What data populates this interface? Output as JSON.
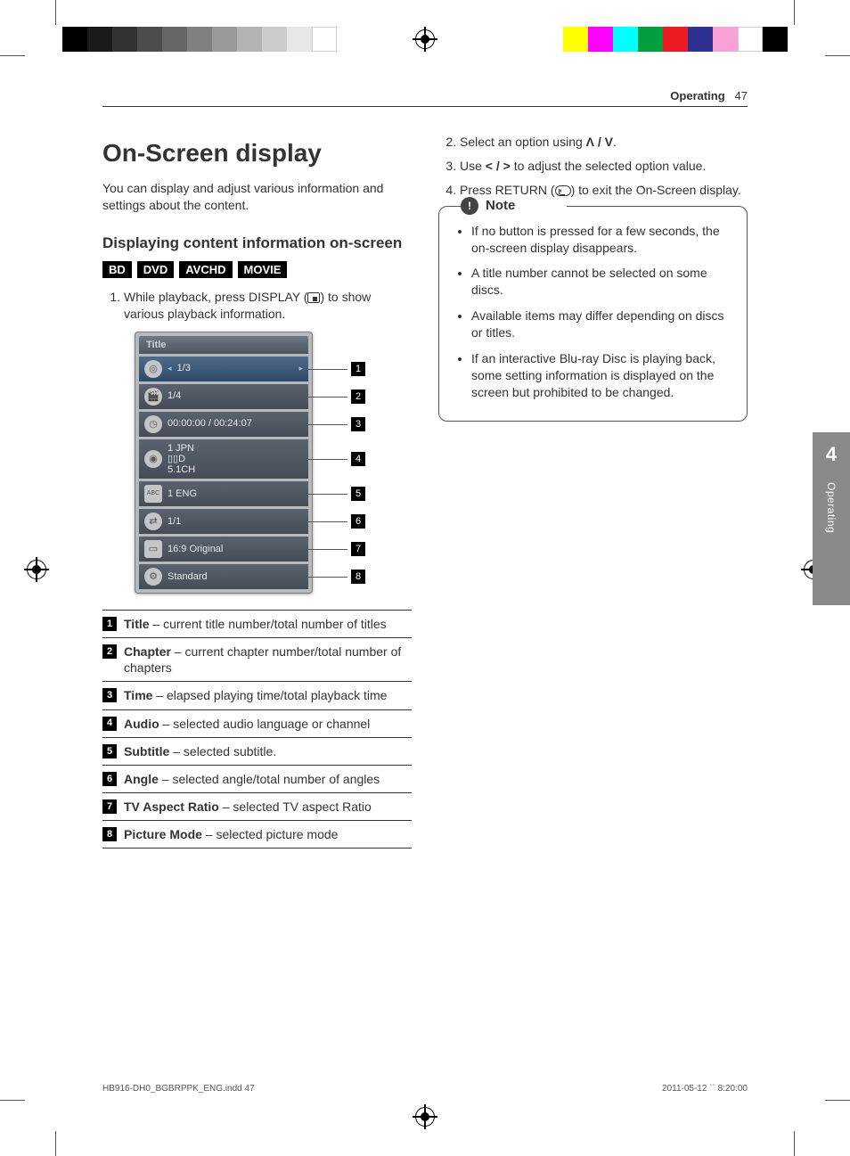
{
  "header": {
    "section": "Operating",
    "page": "47"
  },
  "title": "On-Screen display",
  "intro": "You can display and adjust various information and settings about the content.",
  "subhead": "Displaying content information on-screen",
  "media_badges": [
    "BD",
    "DVD",
    "AVCHD",
    "MOVIE"
  ],
  "step1": {
    "prefix": "While playback, press DISPLAY ",
    "paren_open": "(",
    "paren_close": ")",
    "suffix": " to show various playback information."
  },
  "osd": {
    "panel_title": "Title",
    "rows": [
      {
        "icon": "disc-icon",
        "value": "1/3",
        "arrows": true
      },
      {
        "icon": "clapper-icon",
        "value": "1/4"
      },
      {
        "icon": "clock-icon",
        "value": "00:00:00 / 00:24:07"
      },
      {
        "icon": "audio-icon",
        "value": "1 JPN\n▯▯D\n5.1CH"
      },
      {
        "icon": "subtitle-icon",
        "value": "1 ENG"
      },
      {
        "icon": "angle-icon",
        "value": "1/1"
      },
      {
        "icon": "ratio-icon",
        "value": "16:9 Original"
      },
      {
        "icon": "picture-icon",
        "value": "Standard"
      }
    ]
  },
  "legend": [
    {
      "n": "1",
      "term": "Title",
      "desc": " – current title number/total number of titles"
    },
    {
      "n": "2",
      "term": "Chapter",
      "desc": " – current chapter number/total number of chapters"
    },
    {
      "n": "3",
      "term": "Time",
      "desc": " – elapsed playing time/total playback time"
    },
    {
      "n": "4",
      "term": "Audio",
      "desc": " – selected audio language or channel"
    },
    {
      "n": "5",
      "term": "Subtitle",
      "desc": " – selected subtitle."
    },
    {
      "n": "6",
      "term": "Angle",
      "desc": " – selected angle/total number of angles"
    },
    {
      "n": "7",
      "term": "TV Aspect Ratio",
      "desc": " – selected TV aspect Ratio"
    },
    {
      "n": "8",
      "term": "Picture Mode",
      "desc": " – selected picture mode"
    }
  ],
  "steps_right": {
    "s2": {
      "pre": "Select an option using ",
      "glyphs": "Λ / V",
      "post": "."
    },
    "s3": {
      "pre": "Use ",
      "glyphs": "< / >",
      "post": " to adjust the selected option value."
    },
    "s4": {
      "pre": "Press RETURN (",
      "post": ") to exit the On-Screen display."
    }
  },
  "note": {
    "label": "Note",
    "items": [
      "If no button is pressed for a few seconds, the on-screen display disappears.",
      "A title number cannot be selected on some discs.",
      "Available items may differ depending on discs or titles.",
      "If an interactive Blu-ray Disc is playing back, some setting information is displayed on the screen but prohibited to be changed."
    ]
  },
  "side_tab": {
    "num": "4",
    "label": "Operating"
  },
  "footer": {
    "left": "HB916-DH0_BGBRPPK_ENG.indd   47",
    "right": "2011-05-12   `` 8:20:00"
  }
}
